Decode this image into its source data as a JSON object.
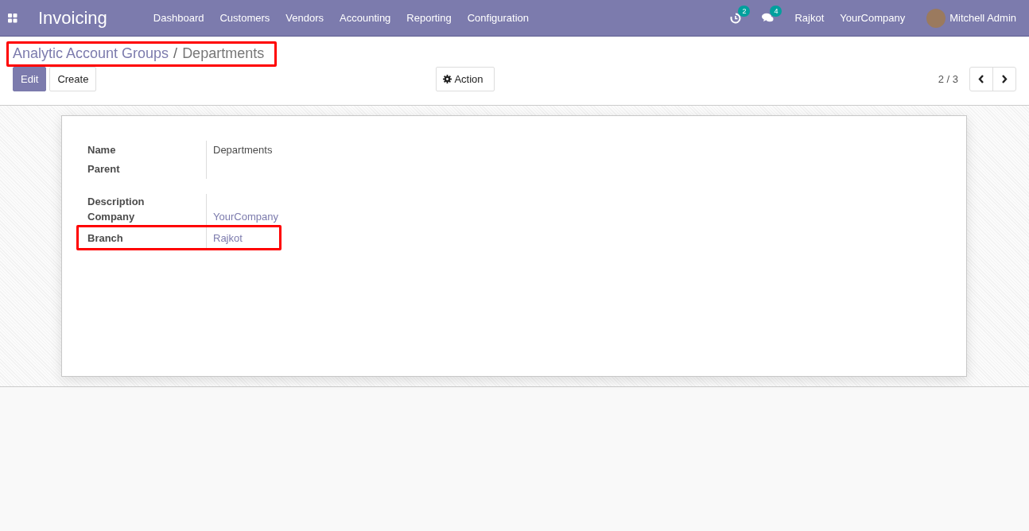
{
  "navbar": {
    "app_title": "Invoicing",
    "menu": [
      "Dashboard",
      "Customers",
      "Vendors",
      "Accounting",
      "Reporting",
      "Configuration"
    ],
    "activity_count": "2",
    "message_count": "4",
    "branch": "Rajkot",
    "company": "YourCompany",
    "user": "Mitchell Admin"
  },
  "breadcrumb": {
    "items": [
      "Analytic Account Groups",
      "Departments"
    ],
    "separator": "/",
    "highlighted": true
  },
  "buttons": [
    {
      "label": "Edit",
      "kind": "primary"
    },
    {
      "label": "Create",
      "kind": "secondary"
    }
  ],
  "action_button": "Action",
  "pager": {
    "counter": "2 / 3"
  },
  "form": {
    "groups": [
      {
        "fields": [
          {
            "label": "Name",
            "value": "Departments",
            "kind": "text",
            "highlighted": false
          },
          {
            "label": "Parent",
            "kind": "text",
            "highlighted": false
          }
        ]
      },
      {
        "fields": [
          {
            "label": "Description",
            "kind": "text",
            "highlighted": false
          },
          {
            "label": "Company",
            "value": "YourCompany",
            "kind": "link",
            "highlighted": false
          },
          {
            "label": "Branch",
            "value": "Rajkot",
            "kind": "link",
            "highlighted": true
          }
        ]
      }
    ]
  }
}
